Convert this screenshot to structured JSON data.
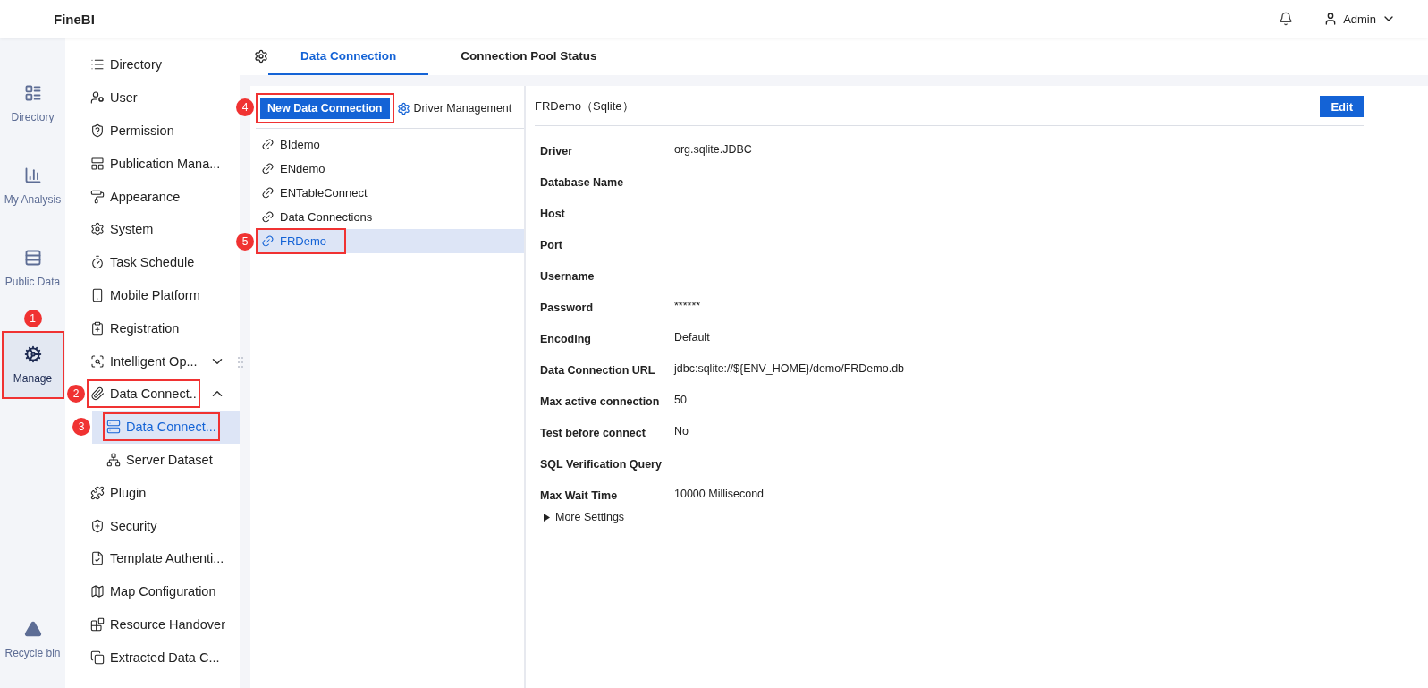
{
  "header": {
    "logo": "FineBI",
    "user": "Admin"
  },
  "rail": [
    {
      "label": "Directory",
      "selected": false
    },
    {
      "label": "My Analysis",
      "selected": false
    },
    {
      "label": "Public Data",
      "selected": false
    },
    {
      "label": "Manage",
      "selected": true,
      "marker": "1",
      "outlined": true
    }
  ],
  "rail_bottom": {
    "label": "Recycle bin"
  },
  "menu": [
    {
      "label": "Directory",
      "selected": false
    },
    {
      "label": "User",
      "selected": false
    },
    {
      "label": "Permission",
      "selected": false
    },
    {
      "label": "Publication Mana...",
      "selected": false
    },
    {
      "label": "Appearance",
      "selected": false
    },
    {
      "label": "System",
      "selected": false
    },
    {
      "label": "Task Schedule",
      "selected": false
    },
    {
      "label": "Mobile Platform",
      "selected": false
    },
    {
      "label": "Registration",
      "selected": false
    },
    {
      "label": "Intelligent Op...",
      "selected": false,
      "expanded": false
    },
    {
      "label": "Data Connect..",
      "selected": false,
      "expanded": true,
      "marker": "2",
      "outlined": true,
      "children": [
        {
          "label": "Data Connect...",
          "selected": true,
          "marker": "3",
          "outlined": true
        },
        {
          "label": "Server Dataset",
          "selected": false
        }
      ]
    },
    {
      "label": "Plugin",
      "selected": false
    },
    {
      "label": "Security",
      "selected": false
    },
    {
      "label": "Template Authenti...",
      "selected": false
    },
    {
      "label": "Map Configuration",
      "selected": false
    },
    {
      "label": "Resource Handover",
      "selected": false
    },
    {
      "label": "Extracted Data C...",
      "selected": false
    }
  ],
  "tabs": [
    {
      "label": "Data Connection",
      "selected": true
    },
    {
      "label": "Connection Pool Status",
      "selected": false
    }
  ],
  "toolbar": {
    "new_button": {
      "label": "New Data Connection",
      "marker": "4",
      "outlined": true
    },
    "driver_button": {
      "label": "Driver Management"
    }
  },
  "connections": [
    {
      "label": "BIdemo",
      "selected": false
    },
    {
      "label": "ENdemo",
      "selected": false
    },
    {
      "label": "ENTableConnect",
      "selected": false
    },
    {
      "label": "Data Connections",
      "selected": false
    },
    {
      "label": "FRDemo",
      "selected": true,
      "marker": "5",
      "outlined": true
    }
  ],
  "detail": {
    "title": "FRDemo（Sqlite）",
    "edit": "Edit",
    "fields": [
      {
        "label": "Driver",
        "value": "org.sqlite.JDBC"
      },
      {
        "label": "Database Name"
      },
      {
        "label": "Host"
      },
      {
        "label": "Port"
      },
      {
        "label": "Username"
      },
      {
        "label": "Password",
        "value": "******"
      },
      {
        "label": "Encoding",
        "value": "Default"
      },
      {
        "label": "Data Connection URL",
        "value": "jdbc:sqlite://${ENV_HOME}/demo/FRDemo.db"
      },
      {
        "label": "Max active connection",
        "value": "50"
      },
      {
        "label": "Test before connect",
        "value": "No"
      },
      {
        "label": "SQL Verification Query"
      },
      {
        "label": "Max Wait Time",
        "value": "10000 Millisecond"
      }
    ],
    "more": "More Settings"
  }
}
